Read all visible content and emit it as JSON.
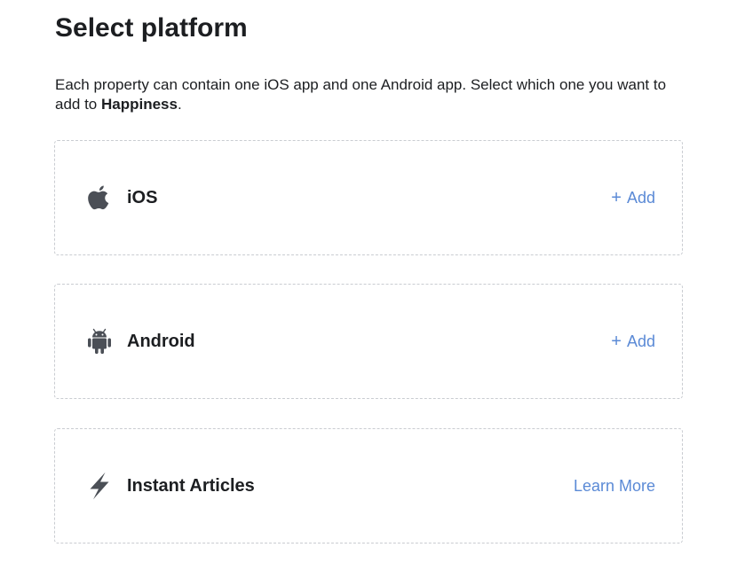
{
  "page": {
    "title": "Select platform",
    "description_prefix": "Each property can contain one iOS app and one Android app. Select which one you want to add to ",
    "property_name": "Happiness",
    "description_suffix": "."
  },
  "platforms": [
    {
      "label": "iOS",
      "icon": "apple-icon",
      "action_plus": "+",
      "action_label": "Add"
    },
    {
      "label": "Android",
      "icon": "android-icon",
      "action_plus": "+",
      "action_label": "Add"
    },
    {
      "label": "Instant Articles",
      "icon": "lightning-icon",
      "action_label": "Learn More"
    }
  ],
  "colors": {
    "link": "#5b8ad6",
    "icon": "#4b4f56",
    "text": "#1c1e21",
    "card_border": "#c9ccd1"
  }
}
